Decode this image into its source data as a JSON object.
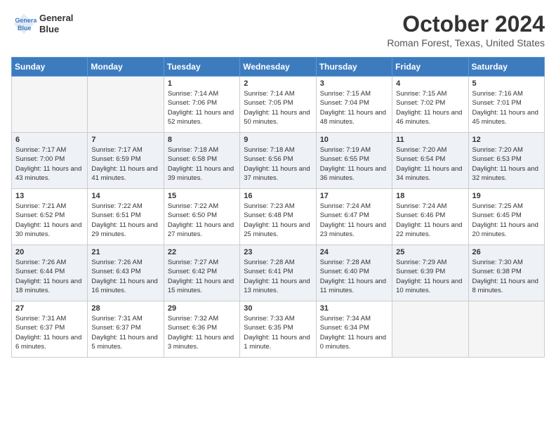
{
  "header": {
    "logo_line1": "General",
    "logo_line2": "Blue",
    "month": "October 2024",
    "location": "Roman Forest, Texas, United States"
  },
  "columns": [
    "Sunday",
    "Monday",
    "Tuesday",
    "Wednesday",
    "Thursday",
    "Friday",
    "Saturday"
  ],
  "weeks": [
    [
      {
        "day": "",
        "info": ""
      },
      {
        "day": "",
        "info": ""
      },
      {
        "day": "1",
        "info": "Sunrise: 7:14 AM\nSunset: 7:06 PM\nDaylight: 11 hours and 52 minutes."
      },
      {
        "day": "2",
        "info": "Sunrise: 7:14 AM\nSunset: 7:05 PM\nDaylight: 11 hours and 50 minutes."
      },
      {
        "day": "3",
        "info": "Sunrise: 7:15 AM\nSunset: 7:04 PM\nDaylight: 11 hours and 48 minutes."
      },
      {
        "day": "4",
        "info": "Sunrise: 7:15 AM\nSunset: 7:02 PM\nDaylight: 11 hours and 46 minutes."
      },
      {
        "day": "5",
        "info": "Sunrise: 7:16 AM\nSunset: 7:01 PM\nDaylight: 11 hours and 45 minutes."
      }
    ],
    [
      {
        "day": "6",
        "info": "Sunrise: 7:17 AM\nSunset: 7:00 PM\nDaylight: 11 hours and 43 minutes."
      },
      {
        "day": "7",
        "info": "Sunrise: 7:17 AM\nSunset: 6:59 PM\nDaylight: 11 hours and 41 minutes."
      },
      {
        "day": "8",
        "info": "Sunrise: 7:18 AM\nSunset: 6:58 PM\nDaylight: 11 hours and 39 minutes."
      },
      {
        "day": "9",
        "info": "Sunrise: 7:18 AM\nSunset: 6:56 PM\nDaylight: 11 hours and 37 minutes."
      },
      {
        "day": "10",
        "info": "Sunrise: 7:19 AM\nSunset: 6:55 PM\nDaylight: 11 hours and 36 minutes."
      },
      {
        "day": "11",
        "info": "Sunrise: 7:20 AM\nSunset: 6:54 PM\nDaylight: 11 hours and 34 minutes."
      },
      {
        "day": "12",
        "info": "Sunrise: 7:20 AM\nSunset: 6:53 PM\nDaylight: 11 hours and 32 minutes."
      }
    ],
    [
      {
        "day": "13",
        "info": "Sunrise: 7:21 AM\nSunset: 6:52 PM\nDaylight: 11 hours and 30 minutes."
      },
      {
        "day": "14",
        "info": "Sunrise: 7:22 AM\nSunset: 6:51 PM\nDaylight: 11 hours and 29 minutes."
      },
      {
        "day": "15",
        "info": "Sunrise: 7:22 AM\nSunset: 6:50 PM\nDaylight: 11 hours and 27 minutes."
      },
      {
        "day": "16",
        "info": "Sunrise: 7:23 AM\nSunset: 6:48 PM\nDaylight: 11 hours and 25 minutes."
      },
      {
        "day": "17",
        "info": "Sunrise: 7:24 AM\nSunset: 6:47 PM\nDaylight: 11 hours and 23 minutes."
      },
      {
        "day": "18",
        "info": "Sunrise: 7:24 AM\nSunset: 6:46 PM\nDaylight: 11 hours and 22 minutes."
      },
      {
        "day": "19",
        "info": "Sunrise: 7:25 AM\nSunset: 6:45 PM\nDaylight: 11 hours and 20 minutes."
      }
    ],
    [
      {
        "day": "20",
        "info": "Sunrise: 7:26 AM\nSunset: 6:44 PM\nDaylight: 11 hours and 18 minutes."
      },
      {
        "day": "21",
        "info": "Sunrise: 7:26 AM\nSunset: 6:43 PM\nDaylight: 11 hours and 16 minutes."
      },
      {
        "day": "22",
        "info": "Sunrise: 7:27 AM\nSunset: 6:42 PM\nDaylight: 11 hours and 15 minutes."
      },
      {
        "day": "23",
        "info": "Sunrise: 7:28 AM\nSunset: 6:41 PM\nDaylight: 11 hours and 13 minutes."
      },
      {
        "day": "24",
        "info": "Sunrise: 7:28 AM\nSunset: 6:40 PM\nDaylight: 11 hours and 11 minutes."
      },
      {
        "day": "25",
        "info": "Sunrise: 7:29 AM\nSunset: 6:39 PM\nDaylight: 11 hours and 10 minutes."
      },
      {
        "day": "26",
        "info": "Sunrise: 7:30 AM\nSunset: 6:38 PM\nDaylight: 11 hours and 8 minutes."
      }
    ],
    [
      {
        "day": "27",
        "info": "Sunrise: 7:31 AM\nSunset: 6:37 PM\nDaylight: 11 hours and 6 minutes."
      },
      {
        "day": "28",
        "info": "Sunrise: 7:31 AM\nSunset: 6:37 PM\nDaylight: 11 hours and 5 minutes."
      },
      {
        "day": "29",
        "info": "Sunrise: 7:32 AM\nSunset: 6:36 PM\nDaylight: 11 hours and 3 minutes."
      },
      {
        "day": "30",
        "info": "Sunrise: 7:33 AM\nSunset: 6:35 PM\nDaylight: 11 hours and 1 minute."
      },
      {
        "day": "31",
        "info": "Sunrise: 7:34 AM\nSunset: 6:34 PM\nDaylight: 11 hours and 0 minutes."
      },
      {
        "day": "",
        "info": ""
      },
      {
        "day": "",
        "info": ""
      }
    ]
  ]
}
